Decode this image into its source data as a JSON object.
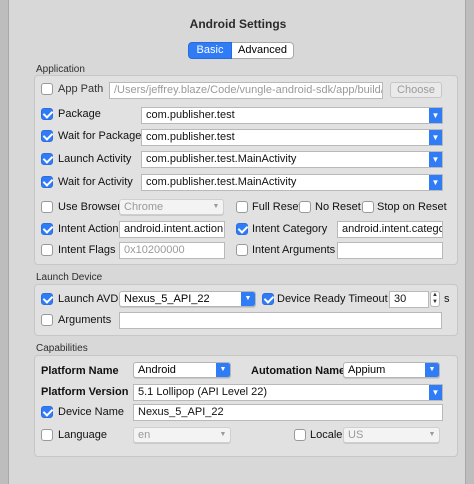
{
  "window": {
    "title": "Android Settings"
  },
  "tabs": [
    {
      "label": "Basic",
      "selected": true
    },
    {
      "label": "Advanced",
      "selected": false
    }
  ],
  "application": {
    "section_label": "Application",
    "app_path": {
      "label": "App Path",
      "checked": false,
      "value": "/Users/jeffrey.blaze/Code/vungle-android-sdk/app/build/outputs",
      "choose_label": "Choose"
    },
    "package": {
      "label": "Package",
      "checked": true,
      "value": "com.publisher.test"
    },
    "wait_for_package": {
      "label": "Wait for Package",
      "checked": true,
      "value": "com.publisher.test"
    },
    "launch_activity": {
      "label": "Launch Activity",
      "checked": true,
      "value": "com.publisher.test.MainActivity"
    },
    "wait_for_activity": {
      "label": "Wait for Activity",
      "checked": true,
      "value": "com.publisher.test.MainActivity"
    },
    "use_browser": {
      "label": "Use Browser",
      "checked": false,
      "value": "Chrome"
    },
    "full_reset": {
      "label": "Full Reset",
      "checked": false
    },
    "no_reset": {
      "label": "No Reset",
      "checked": false
    },
    "stop_on_reset": {
      "label": "Stop on Reset",
      "checked": false
    },
    "intent_action": {
      "label": "Intent Action",
      "checked": true,
      "value": "android.intent.action.MAIN"
    },
    "intent_category": {
      "label": "Intent Category",
      "checked": true,
      "value": "android.intent.category.LAUNCHER"
    },
    "intent_flags": {
      "label": "Intent Flags",
      "checked": false,
      "value": "0x10200000"
    },
    "intent_arguments": {
      "label": "Intent Arguments",
      "checked": false,
      "value": ""
    }
  },
  "launch_device": {
    "section_label": "Launch Device",
    "launch_avd": {
      "label": "Launch AVD",
      "checked": true,
      "value": "Nexus_5_API_22"
    },
    "device_ready_timeout": {
      "label": "Device Ready Timeout",
      "checked": true,
      "value": "30",
      "unit": "s"
    },
    "arguments": {
      "label": "Arguments",
      "checked": false,
      "value": ""
    }
  },
  "capabilities": {
    "section_label": "Capabilities",
    "platform_name": {
      "label": "Platform Name",
      "value": "Android"
    },
    "automation_name": {
      "label": "Automation Name",
      "value": "Appium"
    },
    "platform_version": {
      "label": "Platform Version",
      "value": "5.1 Lollipop (API Level 22)"
    },
    "device_name": {
      "label": "Device Name",
      "checked": true,
      "value": "Nexus_5_API_22"
    },
    "language": {
      "label": "Language",
      "checked": false,
      "value": "en"
    },
    "locale": {
      "label": "Locale",
      "checked": false,
      "value": "US"
    }
  },
  "colors": {
    "accent": "#2f7cf6",
    "panel": "#e1e1e1",
    "window": "#d8d8d8"
  }
}
